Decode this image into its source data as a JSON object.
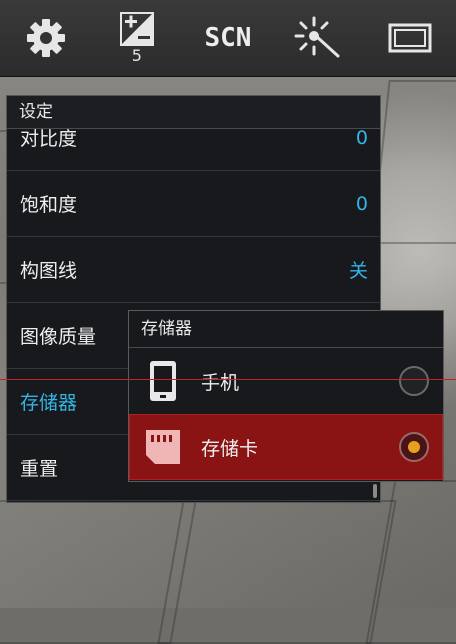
{
  "toolbar": {
    "items": [
      {
        "icon": "gear-icon"
      },
      {
        "icon": "exposure-icon",
        "value": "5"
      },
      {
        "icon": "scene-mode-icon",
        "label": "SCN"
      },
      {
        "icon": "white-balance-icon"
      },
      {
        "icon": "aspect-ratio-icon"
      }
    ]
  },
  "settings": {
    "title": "设定",
    "rows": [
      {
        "label": "对比度",
        "value": "0"
      },
      {
        "label": "饱和度",
        "value": "0"
      },
      {
        "label": "构图线",
        "value": "关"
      },
      {
        "label": "图像质量",
        "value": ""
      },
      {
        "label": "存储器",
        "value": ""
      },
      {
        "label": "重置",
        "value": ""
      }
    ]
  },
  "storage_popup": {
    "title": "存储器",
    "options": [
      {
        "label": "手机",
        "icon": "phone-icon",
        "selected": false
      },
      {
        "label": "存储卡",
        "icon": "sd-card-icon",
        "selected": true
      }
    ]
  },
  "colors": {
    "accent": "#33b5e5",
    "selected_bg": "#8a1414",
    "radio_dot": "#e5a11f",
    "guide_line": "#c8202a"
  }
}
